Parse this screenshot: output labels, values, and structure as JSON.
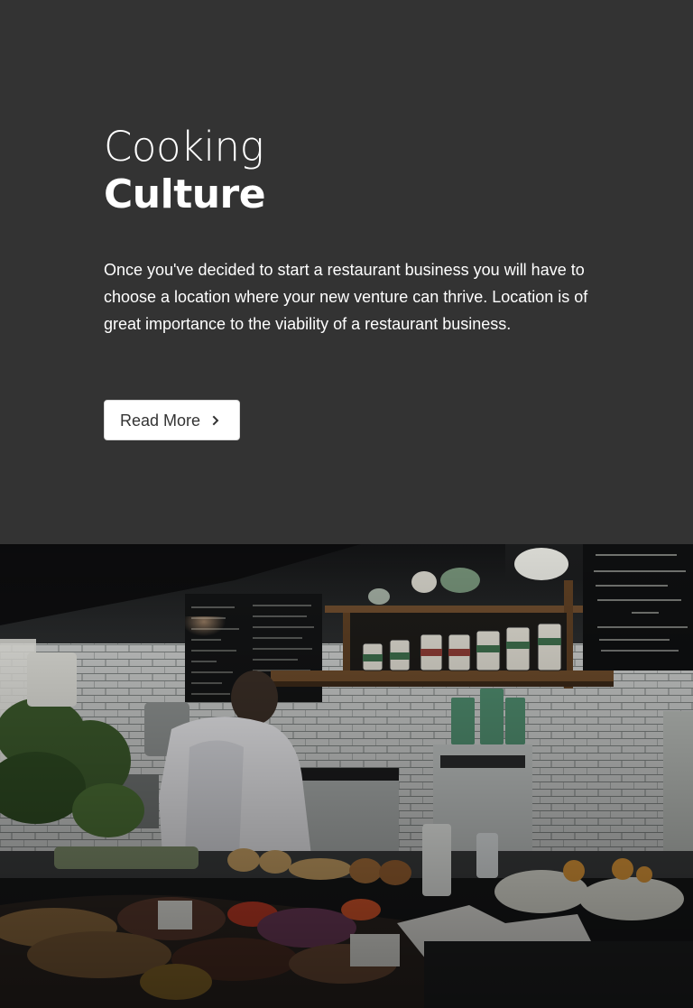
{
  "hero": {
    "title_line1": "Cooking",
    "title_line2": "Culture",
    "body": "Once you've decided to start a restaurant business you will have to choose a location where your new venture can thrive. Location is of great importance to the viability of a restaurant business.",
    "button_label": "Read More",
    "button_icon": "chevron-right-icon"
  },
  "image": {
    "subject": "restaurant-counter-photo",
    "menu_board_right": [
      "EGGS FLORENTINE",
      "ENGLISH MUFFIN",
      "HOMEMADE GRANOLA",
      "OATS",
      "GOLDILOCKS PORRIDGE"
    ]
  },
  "colors": {
    "background": "#333333",
    "text": "#ffffff",
    "button_bg": "#ffffff",
    "button_text": "#333333"
  }
}
